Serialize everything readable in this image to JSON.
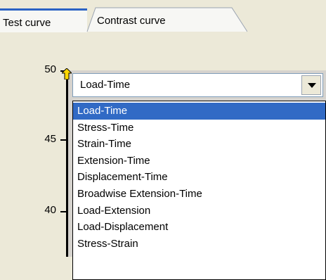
{
  "tabs": [
    {
      "label": "Test curve",
      "active": true
    },
    {
      "label": "Contrast curve",
      "active": false
    }
  ],
  "combo": {
    "selected": "Load-Time"
  },
  "dropdown": {
    "options": [
      "Load-Time",
      "Stress-Time",
      "Strain-Time",
      "Extension-Time",
      "Displacement-Time",
      "Broadwise Extension-Time",
      "Load-Extension",
      "Load-Displacement",
      "Stress-Strain"
    ],
    "selected_index": 0
  },
  "y_axis": {
    "ticks": [
      "50",
      "45",
      "40"
    ]
  },
  "colors": {
    "accent": "#2b62c4",
    "selection": "#316ac5",
    "marker": "#ffd800"
  }
}
